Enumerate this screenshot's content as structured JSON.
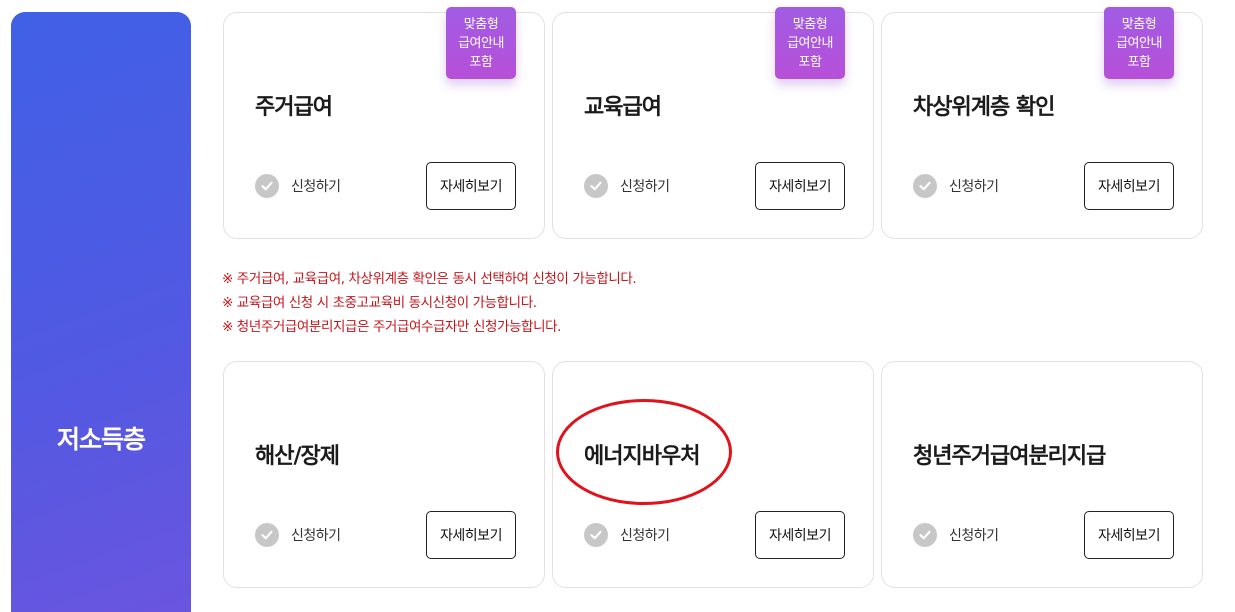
{
  "category": {
    "title": "저소득층"
  },
  "badge_lines": [
    "맞춤형",
    "급여안내",
    "포함"
  ],
  "apply_label": "신청하기",
  "detail_label": "자세히보기",
  "cards_top": [
    {
      "title": "주거급여"
    },
    {
      "title": "교육급여"
    },
    {
      "title": "차상위계층 확인"
    }
  ],
  "notes": [
    "※ 주거급여, 교육급여, 차상위계층 확인은 동시 선택하여 신청이 가능합니다.",
    "※ 교육급여 신청 시 초중고교육비 동시신청이 가능합니다.",
    "※ 청년주거급여분리지급은 주거급여수급자만 신청가능합니다."
  ],
  "cards_bottom": [
    {
      "title": "해산/장제"
    },
    {
      "title": "에너지바우처"
    },
    {
      "title": "청년주거급여분리지급"
    }
  ],
  "colors": {
    "accent_gradient_start": "#4060e6",
    "accent_gradient_end": "#6a55df",
    "badge": "#a15ce4",
    "notice_red": "#c4161c",
    "highlight_circle": "#e0121b"
  }
}
